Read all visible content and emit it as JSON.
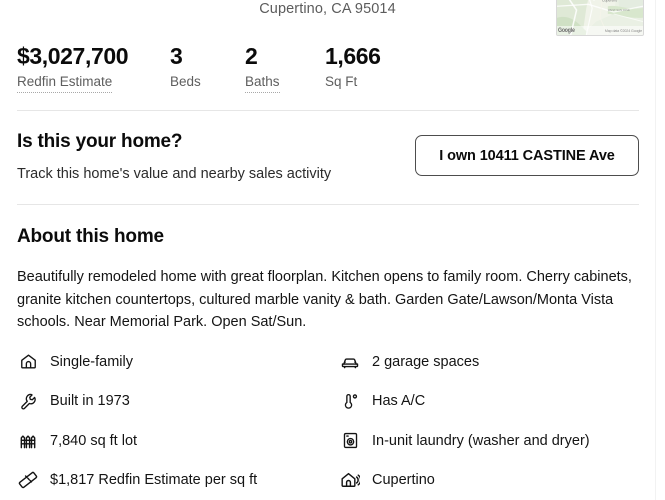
{
  "address": {
    "city_state_zip": "Cupertino, CA 95014"
  },
  "map": {
    "logo_text": "Google",
    "attribution": "Map data ©2024 Google",
    "marker": "map-pin"
  },
  "stats": [
    {
      "value": "$3,027,700",
      "label": "Redfin Estimate",
      "has_tooltip_underline": true
    },
    {
      "value": "3",
      "label": "Beds",
      "has_tooltip_underline": false
    },
    {
      "value": "2",
      "label": "Baths",
      "has_tooltip_underline": true
    },
    {
      "value": "1,666",
      "label": "Sq Ft",
      "has_tooltip_underline": false
    }
  ],
  "own_home": {
    "title": "Is this your home?",
    "subtitle": "Track this home's value and nearby sales activity",
    "button_label": "I own 10411 CASTINE Ave"
  },
  "about": {
    "title": "About this home",
    "description": "Beautifully remodeled home with great floorplan. Kitchen opens to family room. Cherry cabinets, granite kitchen countertops, cultured marble vanity & bath. Garden Gate/Lawson/Monta Vista schools. Near Memorial Park. Open Sat/Sun."
  },
  "features": {
    "left": [
      {
        "icon": "house-icon",
        "text": "Single-family"
      },
      {
        "icon": "wrench-icon",
        "text": "Built in 1973"
      },
      {
        "icon": "fence-icon",
        "text": "7,840 sq ft lot"
      },
      {
        "icon": "ruler-icon",
        "text": "$1,817 Redfin Estimate per sq ft"
      }
    ],
    "right": [
      {
        "icon": "car-icon",
        "text": "2 garage spaces"
      },
      {
        "icon": "thermometer-icon",
        "text": "Has A/C"
      },
      {
        "icon": "washer-icon",
        "text": "In-unit laundry (washer and dryer)"
      },
      {
        "icon": "house-signal-icon",
        "text": "Cupertino"
      }
    ]
  },
  "colors": {
    "text_primary": "#141414",
    "text_secondary": "#5e5e5e",
    "border": "#e6e6e6",
    "button_border": "#4d4d4d"
  }
}
